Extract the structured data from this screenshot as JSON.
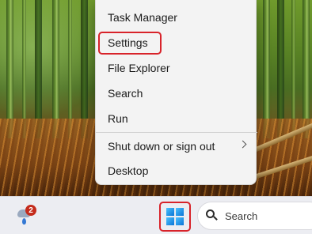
{
  "context_menu": {
    "items": [
      {
        "label": "Task Manager",
        "has_submenu": false
      },
      {
        "label": "Settings",
        "has_submenu": false,
        "highlighted": true
      },
      {
        "label": "File Explorer",
        "has_submenu": false
      },
      {
        "label": "Search",
        "has_submenu": false
      },
      {
        "label": "Run",
        "has_submenu": false
      },
      {
        "label": "Shut down or sign out",
        "has_submenu": true
      },
      {
        "label": "Desktop",
        "has_submenu": false
      }
    ]
  },
  "taskbar": {
    "weather_badge_count": "2",
    "start_button_icon": "windows-logo-icon",
    "start_button_highlighted": true,
    "search_label": "Search"
  },
  "colors": {
    "highlight_border": "#d8232a",
    "menu_background": "#f3f3f3",
    "taskbar_background": "#ecedf2",
    "windows_logo": "#0a74d6"
  }
}
